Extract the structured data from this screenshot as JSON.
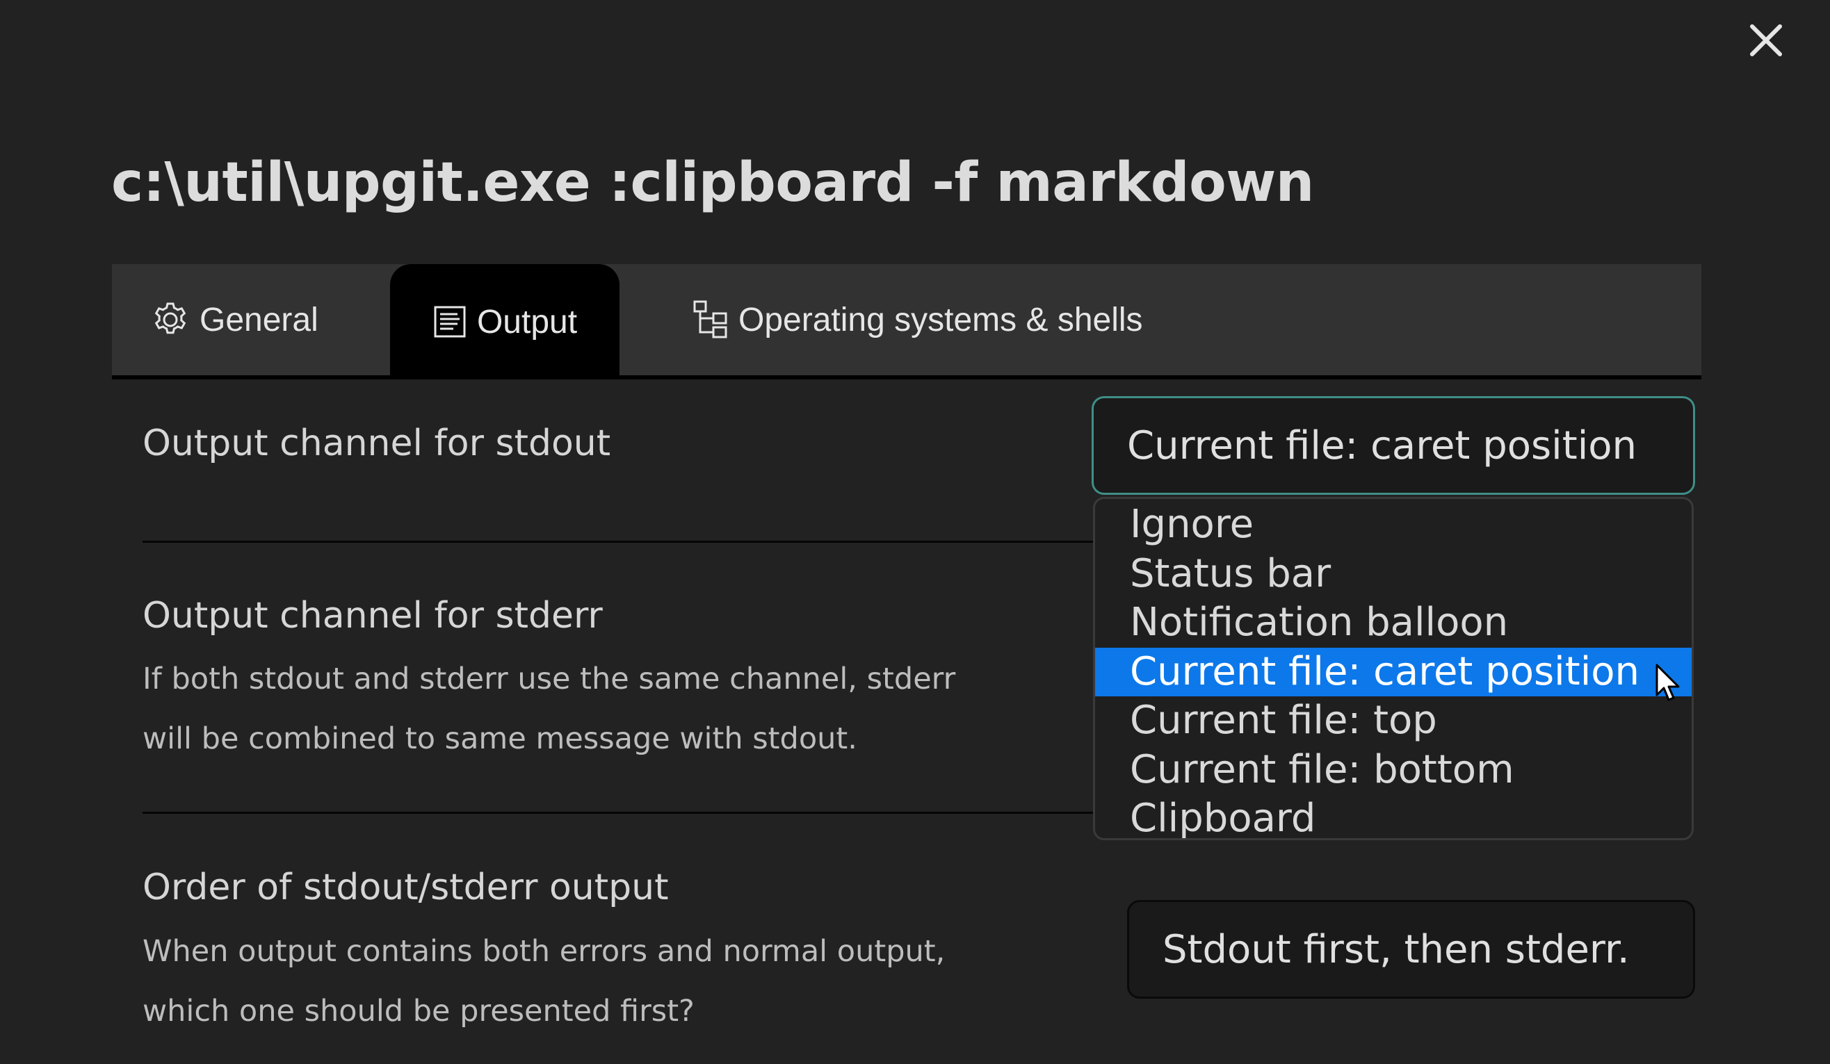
{
  "dialog": {
    "title": "c:\\util\\upgit.exe :clipboard -f markdown",
    "close_icon": "close-icon"
  },
  "tabs": [
    {
      "label": "General",
      "icon": "gear-icon",
      "active": false
    },
    {
      "label": "Output",
      "icon": "document-lines-icon",
      "active": true
    },
    {
      "label": "Operating systems & shells",
      "icon": "tree-icon",
      "active": false
    }
  ],
  "settings": {
    "stdout": {
      "label": "Output channel for stdout",
      "value": "Current file: caret position"
    },
    "stderr": {
      "label": "Output channel for stderr",
      "desc_line1": "If both stdout and stderr use the same channel, stderr",
      "desc_line2": "will be combined to same message with stdout."
    },
    "order": {
      "label": "Order of stdout/stderr output",
      "desc_line1": "When output contains both errors and normal output,",
      "desc_line2": "which one should be presented first?",
      "value": "Stdout first, then stderr."
    }
  },
  "dropdown": {
    "options": [
      "Ignore",
      "Status bar",
      "Notification balloon",
      "Current file: caret position",
      "Current file: top",
      "Current file: bottom",
      "Clipboard"
    ],
    "highlighted_index": 3
  },
  "colors": {
    "background": "#222222",
    "tabbar": "#323232",
    "active_tab": "#000000",
    "highlight": "#0d78ea",
    "focus_border": "#3f8f86",
    "caret": "#6a4fd6"
  }
}
